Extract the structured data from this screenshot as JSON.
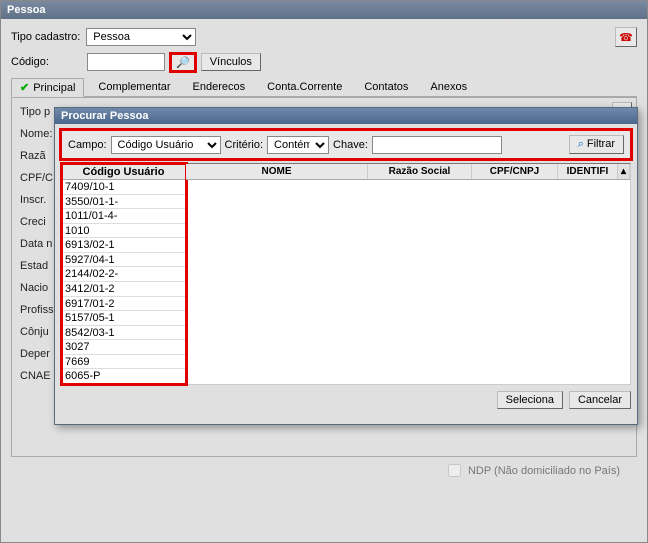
{
  "window": {
    "title": "Pessoa"
  },
  "top": {
    "tipo_label": "Tipo cadastro:",
    "tipo_value": "Pessoa",
    "codigo_label": "Código:",
    "vinculos_label": "Vínculos"
  },
  "tabs": {
    "principal": "Principal",
    "complementar": "Complementar",
    "enderecos": "Enderecos",
    "conta_corrente": "Conta.Corrente",
    "contatos": "Contatos",
    "anexos": "Anexos"
  },
  "bg_labels": {
    "tipo_p": "Tipo p",
    "nomes": "Nome:",
    "razao": "Razã",
    "cpf_c": "CPF/C",
    "inscr": "Inscr.",
    "creci": "Creci",
    "data_n": "Data n",
    "estado": "Estad",
    "nacior": "Nacio",
    "profiss": "Profiss",
    "conju": "Cônju",
    "deper": "Deper",
    "cnae": "CNAE"
  },
  "dialog": {
    "title": "Procurar Pessoa",
    "campo_label": "Campo:",
    "campo_value": "Código Usuário",
    "criterio_label": "Critério:",
    "criterio_value": "Contém",
    "chave_label": "Chave:",
    "chave_value": "",
    "filtrar_label": "Filtrar",
    "columns": {
      "codigo": "Código Usuário",
      "nome": "NOME",
      "razao": "Razão Social",
      "cpfcnpj": "CPF/CNPJ",
      "ident": "IDENTIFI"
    },
    "codigo_rows": [
      "7409/10-1",
      "3550/01-1-",
      "1011/01-4-",
      "1010",
      "6913/02-1",
      "5927/04-1",
      "2144/02-2-",
      "3412/01-2",
      "6917/01-2",
      "5157/05-1",
      "8542/03-1",
      "3027",
      "7669",
      "6065-P"
    ],
    "seleciona_label": "Seleciona",
    "cancelar_label": "Cancelar"
  },
  "ndp_label": "NDP (Não domiciliado no País)"
}
